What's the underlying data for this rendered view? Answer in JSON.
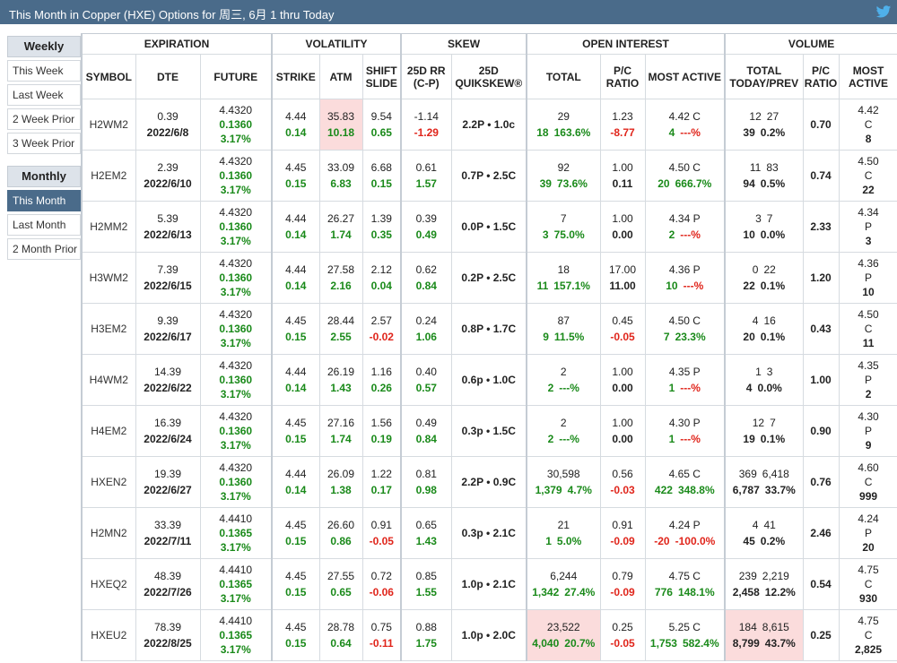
{
  "header": {
    "title": "This Month in Copper (HXE) Options for 周三, 6月 1 thru Today",
    "icon": "twitter-icon",
    "bar_color": "#4a6b8a"
  },
  "sidebar": {
    "weekly_label": "Weekly",
    "weekly_items": [
      "This Week",
      "Last Week",
      "2 Week Prior",
      "3 Week Prior"
    ],
    "monthly_label": "Monthly",
    "monthly_items": [
      "This Month",
      "Last Month",
      "2 Month Prior"
    ],
    "active": "This Month"
  },
  "groups": [
    "EXPIRATION",
    "VOLATILITY",
    "SKEW",
    "OPEN INTEREST",
    "VOLUME"
  ],
  "columns": {
    "symbol": "SYMBOL",
    "dte": "DTE",
    "future": "FUTURE",
    "strike": "STRIKE",
    "atm": "ATM",
    "shift_slide": "SHIFT SLIDE",
    "rr": "25D RR (C-P)",
    "quikskew": "25D QUIKSKEW®",
    "oi_total": "TOTAL",
    "oi_pc": "P/C RATIO",
    "oi_most": "MOST ACTIVE",
    "vol_total": "TOTAL TODAY/PREV",
    "vol_pc": "P/C RATIO",
    "vol_most": "MOST ACTIVE"
  },
  "rows": [
    {
      "symbol": "H2WM2",
      "dte": "0.39",
      "date": "2022/6/8",
      "future": "4.4320",
      "fut_chg": "0.1360",
      "fut_pct": "3.17%",
      "strike": "4.44",
      "strike2": "0.14",
      "atm": "35.83",
      "atm2": "10.18",
      "atm_hl": true,
      "shift": "9.54",
      "shift2": "0.65",
      "rr": "-1.14",
      "rr2": "-1.29",
      "qs": "2.2P • 1.0c",
      "oi": "29",
      "oi2": "18",
      "oi3": "163.6%",
      "oi_hl": false,
      "pc": "1.23",
      "pc2": "-8.77",
      "ma": "4.42 C",
      "ma2": "4",
      "ma3": "---%",
      "vt": "12",
      "vp": "27",
      "vt2": "39",
      "vt3": "0.2%",
      "vol_hl": false,
      "vpc": "0.70",
      "vma": "4.42",
      "vma2": "C",
      "vma3": "8"
    },
    {
      "symbol": "H2EM2",
      "dte": "2.39",
      "date": "2022/6/10",
      "future": "4.4320",
      "fut_chg": "0.1360",
      "fut_pct": "3.17%",
      "strike": "4.45",
      "strike2": "0.15",
      "atm": "33.09",
      "atm2": "6.83",
      "atm_hl": false,
      "shift": "6.68",
      "shift2": "0.15",
      "rr": "0.61",
      "rr2": "1.57",
      "qs": "0.7P • 2.5C",
      "oi": "92",
      "oi2": "39",
      "oi3": "73.6%",
      "oi_hl": false,
      "pc": "1.00",
      "pc2": "0.11",
      "ma": "4.50 C",
      "ma2": "20",
      "ma3": "666.7%",
      "vt": "11",
      "vp": "83",
      "vt2": "94",
      "vt3": "0.5%",
      "vol_hl": false,
      "vpc": "0.74",
      "vma": "4.50",
      "vma2": "C",
      "vma3": "22"
    },
    {
      "symbol": "H2MM2",
      "dte": "5.39",
      "date": "2022/6/13",
      "future": "4.4320",
      "fut_chg": "0.1360",
      "fut_pct": "3.17%",
      "strike": "4.44",
      "strike2": "0.14",
      "atm": "26.27",
      "atm2": "1.74",
      "atm_hl": false,
      "shift": "1.39",
      "shift2": "0.35",
      "rr": "0.39",
      "rr2": "0.49",
      "qs": "0.0P • 1.5C",
      "oi": "7",
      "oi2": "3",
      "oi3": "75.0%",
      "oi_hl": false,
      "pc": "1.00",
      "pc2": "0.00",
      "ma": "4.34 P",
      "ma2": "2",
      "ma3": "---%",
      "vt": "3",
      "vp": "7",
      "vt2": "10",
      "vt3": "0.0%",
      "vol_hl": false,
      "vpc": "2.33",
      "vma": "4.34",
      "vma2": "P",
      "vma3": "3"
    },
    {
      "symbol": "H3WM2",
      "dte": "7.39",
      "date": "2022/6/15",
      "future": "4.4320",
      "fut_chg": "0.1360",
      "fut_pct": "3.17%",
      "strike": "4.44",
      "strike2": "0.14",
      "atm": "27.58",
      "atm2": "2.16",
      "atm_hl": false,
      "shift": "2.12",
      "shift2": "0.04",
      "rr": "0.62",
      "rr2": "0.84",
      "qs": "0.2P • 2.5C",
      "oi": "18",
      "oi2": "11",
      "oi3": "157.1%",
      "oi_hl": false,
      "pc": "17.00",
      "pc2": "11.00",
      "ma": "4.36 P",
      "ma2": "10",
      "ma3": "---%",
      "vt": "0",
      "vp": "22",
      "vt2": "22",
      "vt3": "0.1%",
      "vol_hl": false,
      "vpc": "1.20",
      "vma": "4.36",
      "vma2": "P",
      "vma3": "10"
    },
    {
      "symbol": "H3EM2",
      "dte": "9.39",
      "date": "2022/6/17",
      "future": "4.4320",
      "fut_chg": "0.1360",
      "fut_pct": "3.17%",
      "strike": "4.45",
      "strike2": "0.15",
      "atm": "28.44",
      "atm2": "2.55",
      "atm_hl": false,
      "shift": "2.57",
      "shift2": "-0.02",
      "rr": "0.24",
      "rr2": "1.06",
      "qs": "0.8P • 1.7C",
      "oi": "87",
      "oi2": "9",
      "oi3": "11.5%",
      "oi_hl": false,
      "pc": "0.45",
      "pc2": "-0.05",
      "ma": "4.50 C",
      "ma2": "7",
      "ma3": "23.3%",
      "vt": "4",
      "vp": "16",
      "vt2": "20",
      "vt3": "0.1%",
      "vol_hl": false,
      "vpc": "0.43",
      "vma": "4.50",
      "vma2": "C",
      "vma3": "11"
    },
    {
      "symbol": "H4WM2",
      "dte": "14.39",
      "date": "2022/6/22",
      "future": "4.4320",
      "fut_chg": "0.1360",
      "fut_pct": "3.17%",
      "strike": "4.44",
      "strike2": "0.14",
      "atm": "26.19",
      "atm2": "1.43",
      "atm_hl": false,
      "shift": "1.16",
      "shift2": "0.26",
      "rr": "0.40",
      "rr2": "0.57",
      "qs": "0.6p • 1.0C",
      "oi": "2",
      "oi2": "2",
      "oi3": "---%",
      "oi_hl": false,
      "pc": "1.00",
      "pc2": "0.00",
      "ma": "4.35 P",
      "ma2": "1",
      "ma3": "---%",
      "vt": "1",
      "vp": "3",
      "vt2": "4",
      "vt3": "0.0%",
      "vol_hl": false,
      "vpc": "1.00",
      "vma": "4.35",
      "vma2": "P",
      "vma3": "2"
    },
    {
      "symbol": "H4EM2",
      "dte": "16.39",
      "date": "2022/6/24",
      "future": "4.4320",
      "fut_chg": "0.1360",
      "fut_pct": "3.17%",
      "strike": "4.45",
      "strike2": "0.15",
      "atm": "27.16",
      "atm2": "1.74",
      "atm_hl": false,
      "shift": "1.56",
      "shift2": "0.19",
      "rr": "0.49",
      "rr2": "0.84",
      "qs": "0.3p • 1.5C",
      "oi": "2",
      "oi2": "2",
      "oi3": "---%",
      "oi_hl": false,
      "pc": "1.00",
      "pc2": "0.00",
      "ma": "4.30 P",
      "ma2": "1",
      "ma3": "---%",
      "vt": "12",
      "vp": "7",
      "vt2": "19",
      "vt3": "0.1%",
      "vol_hl": false,
      "vpc": "0.90",
      "vma": "4.30",
      "vma2": "P",
      "vma3": "9"
    },
    {
      "symbol": "HXEN2",
      "dte": "19.39",
      "date": "2022/6/27",
      "future": "4.4320",
      "fut_chg": "0.1360",
      "fut_pct": "3.17%",
      "strike": "4.44",
      "strike2": "0.14",
      "atm": "26.09",
      "atm2": "1.38",
      "atm_hl": false,
      "shift": "1.22",
      "shift2": "0.17",
      "rr": "0.81",
      "rr2": "0.98",
      "qs": "2.2P • 0.9C",
      "oi": "30,598",
      "oi2": "1,379",
      "oi3": "4.7%",
      "oi_hl": false,
      "pc": "0.56",
      "pc2": "-0.03",
      "ma": "4.65 C",
      "ma2": "422",
      "ma3": "348.8%",
      "vt": "369",
      "vp": "6,418",
      "vt2": "6,787",
      "vt3": "33.7%",
      "vol_hl": false,
      "vpc": "0.76",
      "vma": "4.60",
      "vma2": "C",
      "vma3": "999"
    },
    {
      "symbol": "H2MN2",
      "dte": "33.39",
      "date": "2022/7/11",
      "future": "4.4410",
      "fut_chg": "0.1365",
      "fut_pct": "3.17%",
      "strike": "4.45",
      "strike2": "0.15",
      "atm": "26.60",
      "atm2": "0.86",
      "atm_hl": false,
      "shift": "0.91",
      "shift2": "-0.05",
      "rr": "0.65",
      "rr2": "1.43",
      "qs": "0.3p • 2.1C",
      "oi": "21",
      "oi2": "1",
      "oi3": "5.0%",
      "oi_hl": false,
      "pc": "0.91",
      "pc2": "-0.09",
      "ma": "4.24 P",
      "ma2": "-20",
      "ma3": "-100.0%",
      "vt": "4",
      "vp": "41",
      "vt2": "45",
      "vt3": "0.2%",
      "vol_hl": false,
      "vpc": "2.46",
      "vma": "4.24",
      "vma2": "P",
      "vma3": "20"
    },
    {
      "symbol": "HXEQ2",
      "dte": "48.39",
      "date": "2022/7/26",
      "future": "4.4410",
      "fut_chg": "0.1365",
      "fut_pct": "3.17%",
      "strike": "4.45",
      "strike2": "0.15",
      "atm": "27.55",
      "atm2": "0.65",
      "atm_hl": false,
      "shift": "0.72",
      "shift2": "-0.06",
      "rr": "0.85",
      "rr2": "1.55",
      "qs": "1.0p • 2.1C",
      "oi": "6,244",
      "oi2": "1,342",
      "oi3": "27.4%",
      "oi_hl": false,
      "pc": "0.79",
      "pc2": "-0.09",
      "ma": "4.75 C",
      "ma2": "776",
      "ma3": "148.1%",
      "vt": "239",
      "vp": "2,219",
      "vt2": "2,458",
      "vt3": "12.2%",
      "vol_hl": false,
      "vpc": "0.54",
      "vma": "4.75",
      "vma2": "C",
      "vma3": "930"
    },
    {
      "symbol": "HXEU2",
      "dte": "78.39",
      "date": "2022/8/25",
      "future": "4.4410",
      "fut_chg": "0.1365",
      "fut_pct": "3.17%",
      "strike": "4.45",
      "strike2": "0.15",
      "atm": "28.78",
      "atm2": "0.64",
      "atm_hl": false,
      "shift": "0.75",
      "shift2": "-0.11",
      "rr": "0.88",
      "rr2": "1.75",
      "qs": "1.0p • 2.0C",
      "oi": "23,522",
      "oi2": "4,040",
      "oi3": "20.7%",
      "oi_hl": true,
      "pc": "0.25",
      "pc2": "-0.05",
      "ma": "5.25 C",
      "ma2": "1,753",
      "ma3": "582.4%",
      "vt": "184",
      "vp": "8,615",
      "vt2": "8,799",
      "vt3": "43.7%",
      "vol_hl": true,
      "vpc": "0.25",
      "vma": "4.75",
      "vma2": "C",
      "vma3": "2,825"
    }
  ]
}
